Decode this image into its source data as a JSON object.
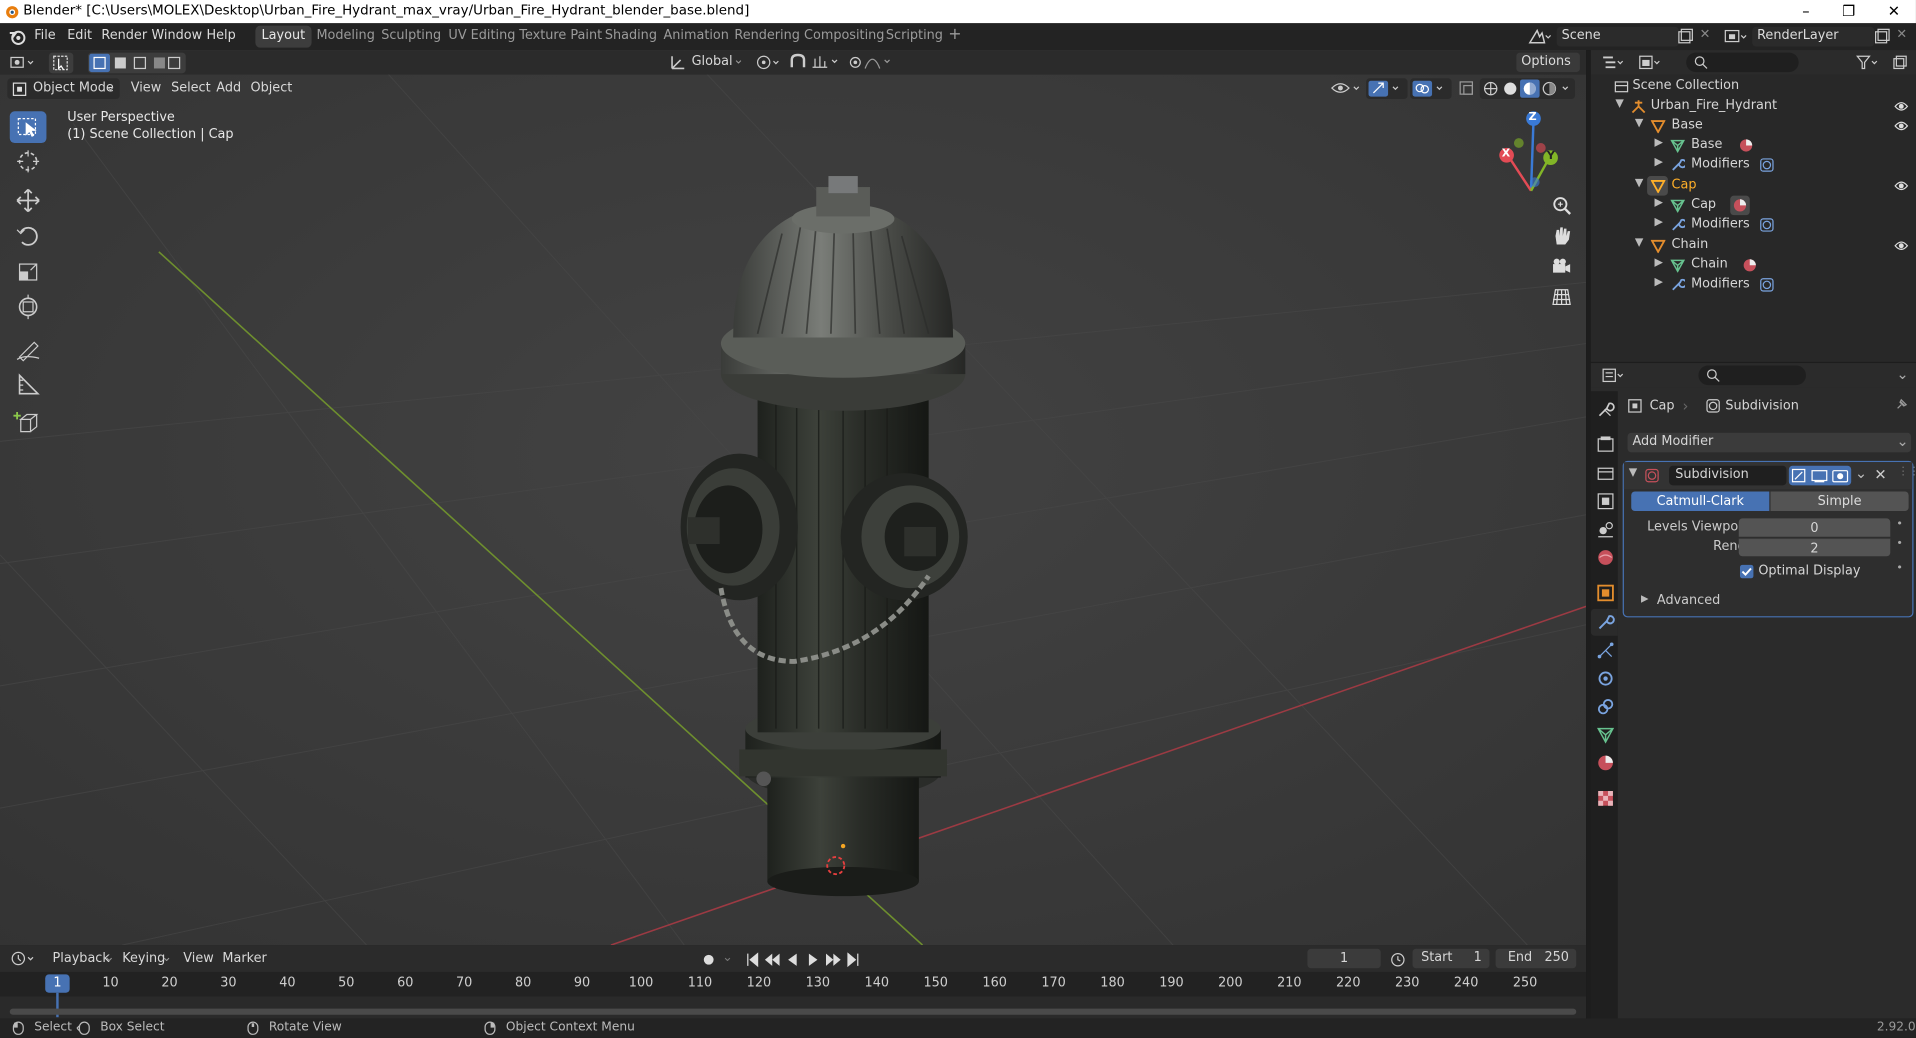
{
  "window": {
    "title": "Blender* [C:\\Users\\MOLEX\\Desktop\\Urban_Fire_Hydrant_max_vray/Urban_Fire_Hydrant_blender_base.blend]",
    "minimize": "–",
    "restore": "❐",
    "close": "✕"
  },
  "menu": {
    "items": [
      "File",
      "Edit",
      "Render",
      "Window",
      "Help"
    ],
    "workspaces": [
      "Layout",
      "Modeling",
      "Sculpting",
      "UV Editing",
      "Texture Paint",
      "Shading",
      "Animation",
      "Rendering",
      "Compositing",
      "Scripting"
    ],
    "active_workspace": "Layout",
    "add_workspace": "+",
    "scene_label": "Scene",
    "renderlayer_label": "RenderLayer"
  },
  "viewport_header": {
    "mode": "Object Mode",
    "menus": [
      "View",
      "Select",
      "Add",
      "Object"
    ],
    "transform_orientation": "Global",
    "options_label": "Options"
  },
  "viewport": {
    "perspective_label": "User Perspective",
    "collection_label": "(1) Scene Collection | Cap",
    "gizmo_axes": {
      "x": "X",
      "y": "Y",
      "z": "Z"
    },
    "colors": {
      "x_axis": "#e34b55",
      "y_axis": "#82b527",
      "z_axis": "#3a7ad6",
      "active_tool": "#4772b3"
    }
  },
  "toolbar": {
    "tools": [
      "select-box-icon",
      "cursor-icon",
      "move-icon",
      "rotate-icon",
      "scale-icon",
      "transform-icon",
      "annotate-icon",
      "measure-icon",
      "add-cube-icon"
    ]
  },
  "outliner": {
    "root": "Scene Collection",
    "rows": [
      {
        "label": "Urban_Fire_Hydrant",
        "level": 1,
        "type": "collection"
      },
      {
        "label": "Base",
        "level": 2,
        "type": "object"
      },
      {
        "label": "Base",
        "level": 3,
        "type": "mesh"
      },
      {
        "label": "Modifiers",
        "level": 3,
        "type": "modifier"
      },
      {
        "label": "Cap",
        "level": 2,
        "type": "object"
      },
      {
        "label": "Cap",
        "level": 3,
        "type": "mesh"
      },
      {
        "label": "Modifiers",
        "level": 3,
        "type": "modifier"
      },
      {
        "label": "Chain",
        "level": 2,
        "type": "object"
      },
      {
        "label": "Chain",
        "level": 3,
        "type": "mesh"
      },
      {
        "label": "Modifiers",
        "level": 3,
        "type": "modifier"
      }
    ]
  },
  "properties": {
    "breadcrumb_object": "Cap",
    "breadcrumb_modifier": "Subdivision",
    "add_modifier": "Add Modifier",
    "modifier_name": "Subdivision",
    "algo_options": [
      "Catmull-Clark",
      "Simple"
    ],
    "algo_selected": "Catmull-Clark",
    "levels_viewport_label": "Levels Viewport",
    "levels_viewport_value": "0",
    "render_label": "Render",
    "render_value": "2",
    "optimal_display_label": "Optimal Display",
    "optimal_display_checked": true,
    "advanced_label": "Advanced"
  },
  "timeline": {
    "menus": [
      "Playback",
      "Keying",
      "View",
      "Marker"
    ],
    "current_frame": "1",
    "start_label": "Start",
    "start_value": "1",
    "end_label": "End",
    "end_value": "250",
    "ruler_ticks": [
      "1",
      "10",
      "20",
      "30",
      "40",
      "50",
      "60",
      "70",
      "80",
      "90",
      "100",
      "110",
      "120",
      "130",
      "140",
      "150",
      "160",
      "170",
      "180",
      "190",
      "200",
      "210",
      "220",
      "230",
      "240",
      "250"
    ]
  },
  "statusbar": {
    "items": [
      "Select",
      "Box Select",
      "Rotate View",
      "Object Context Menu"
    ],
    "version": "2.92.0"
  }
}
